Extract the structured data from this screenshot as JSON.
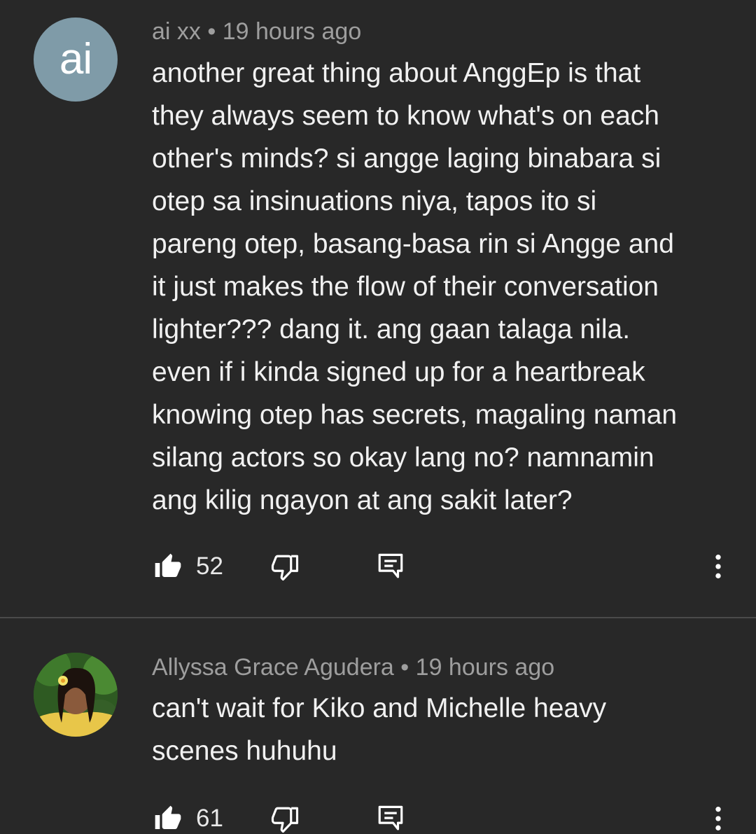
{
  "comments": [
    {
      "avatar_letters": "ai",
      "author": "ai xx",
      "separator": "•",
      "time": "19 hours ago",
      "text": "another great thing about AnggEp is that\nthey always seem to know what's on each\nother's minds? si angge laging binabara si\notep sa insinuations niya,  tapos ito si\npareng otep, basang-basa rin si Angge and\nit just makes the flow of their conversation\nlighter??? dang it. ang gaan talaga nila.\neven if i kinda signed up for a heartbreak\nknowing otep has secrets, magaling naman\nsilang actors so okay lang no? namnamin\nang kilig ngayon at ang sakit later?",
      "likes": "52"
    },
    {
      "author": "Allyssa Grace Agudera",
      "separator": "•",
      "time": "19 hours ago",
      "text": "can't wait for Kiko and Michelle heavy\nscenes huhuhu",
      "likes": "61"
    }
  ],
  "icons": {
    "like": "thumbs-up-icon",
    "dislike": "thumbs-down-icon",
    "reply": "reply-icon",
    "menu": "more-vert-icon"
  },
  "colors": {
    "background": "#282828",
    "text": "#f1f1f1",
    "meta": "#9e9e9e",
    "avatar": "#7f9ba8"
  }
}
